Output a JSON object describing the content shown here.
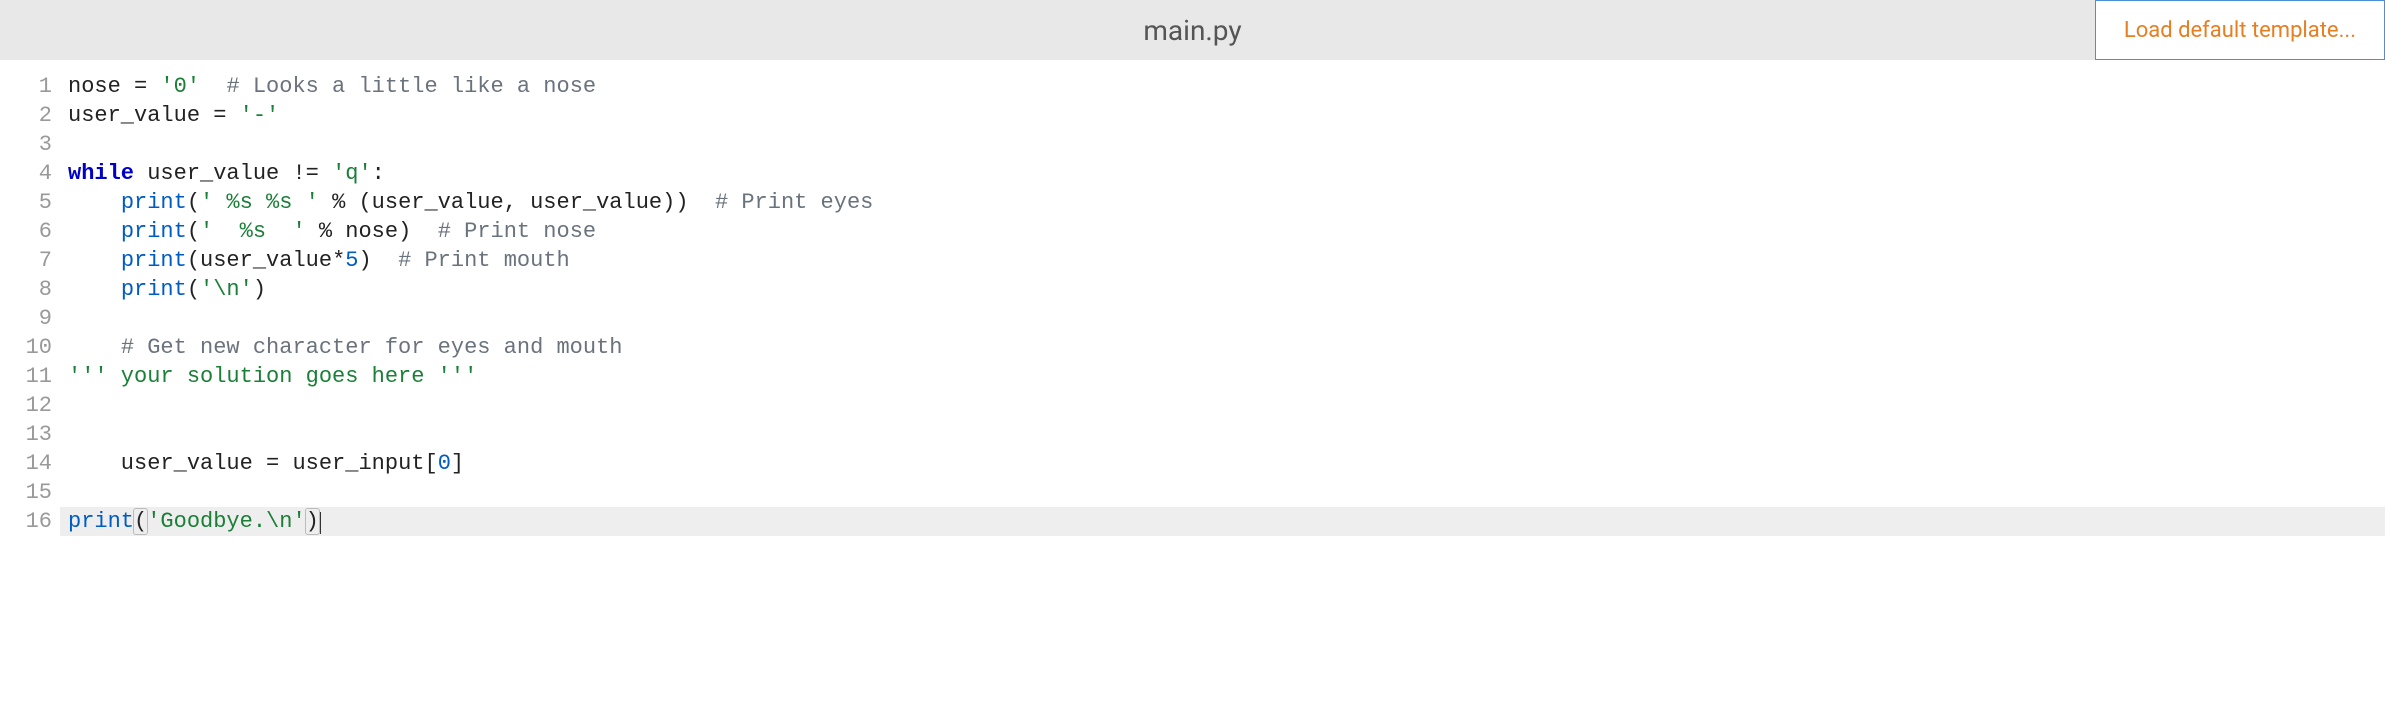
{
  "header": {
    "filename": "main.py",
    "loadTemplateLabel": "Load default template..."
  },
  "editor": {
    "activeLine": 16,
    "lineNumbers": [
      "1",
      "2",
      "3",
      "4",
      "5",
      "6",
      "7",
      "8",
      "9",
      "10",
      "11",
      "12",
      "13",
      "14",
      "15",
      "16"
    ],
    "lines": [
      [
        {
          "cls": "",
          "text": "nose "
        },
        {
          "cls": "tok-op",
          "text": "= "
        },
        {
          "cls": "tok-string",
          "text": "'0'"
        },
        {
          "cls": "",
          "text": "  "
        },
        {
          "cls": "tok-comment",
          "text": "# Looks a little like a nose"
        }
      ],
      [
        {
          "cls": "",
          "text": "user_value "
        },
        {
          "cls": "tok-op",
          "text": "= "
        },
        {
          "cls": "tok-string",
          "text": "'-'"
        }
      ],
      [],
      [
        {
          "cls": "tok-keyword",
          "text": "while"
        },
        {
          "cls": "",
          "text": " user_value "
        },
        {
          "cls": "tok-op",
          "text": "!= "
        },
        {
          "cls": "tok-string",
          "text": "'q'"
        },
        {
          "cls": "",
          "text": ":"
        }
      ],
      [
        {
          "cls": "",
          "text": "    "
        },
        {
          "cls": "tok-builtin",
          "text": "print"
        },
        {
          "cls": "",
          "text": "("
        },
        {
          "cls": "tok-string",
          "text": "' %s %s '"
        },
        {
          "cls": "",
          "text": " "
        },
        {
          "cls": "tok-op",
          "text": "%"
        },
        {
          "cls": "",
          "text": " (user_value, user_value))  "
        },
        {
          "cls": "tok-comment",
          "text": "# Print eyes"
        }
      ],
      [
        {
          "cls": "",
          "text": "    "
        },
        {
          "cls": "tok-builtin",
          "text": "print"
        },
        {
          "cls": "",
          "text": "("
        },
        {
          "cls": "tok-string",
          "text": "'  %s  '"
        },
        {
          "cls": "",
          "text": " "
        },
        {
          "cls": "tok-op",
          "text": "%"
        },
        {
          "cls": "",
          "text": " nose)  "
        },
        {
          "cls": "tok-comment",
          "text": "# Print nose"
        }
      ],
      [
        {
          "cls": "",
          "text": "    "
        },
        {
          "cls": "tok-builtin",
          "text": "print"
        },
        {
          "cls": "",
          "text": "(user_value"
        },
        {
          "cls": "tok-op",
          "text": "*"
        },
        {
          "cls": "tok-number",
          "text": "5"
        },
        {
          "cls": "",
          "text": ")  "
        },
        {
          "cls": "tok-comment",
          "text": "# Print mouth"
        }
      ],
      [
        {
          "cls": "",
          "text": "    "
        },
        {
          "cls": "tok-builtin",
          "text": "print"
        },
        {
          "cls": "",
          "text": "("
        },
        {
          "cls": "tok-string",
          "text": "'\\n'"
        },
        {
          "cls": "",
          "text": ")"
        }
      ],
      [],
      [
        {
          "cls": "",
          "text": "    "
        },
        {
          "cls": "tok-comment",
          "text": "# Get new character for eyes and mouth"
        }
      ],
      [
        {
          "cls": "tok-string",
          "text": "''' your solution goes here '''"
        }
      ],
      [],
      [],
      [
        {
          "cls": "",
          "text": "    user_value "
        },
        {
          "cls": "tok-op",
          "text": "= "
        },
        {
          "cls": "",
          "text": "user_input["
        },
        {
          "cls": "tok-number",
          "text": "0"
        },
        {
          "cls": "",
          "text": "]"
        }
      ],
      [],
      [
        {
          "cls": "tok-builtin",
          "text": "print"
        },
        {
          "cls": "bracket-highlight",
          "text": "("
        },
        {
          "cls": "tok-string",
          "text": "'Goodbye.\\n'"
        },
        {
          "cls": "bracket-highlight",
          "text": ")"
        },
        {
          "cls": "cursor",
          "text": ""
        }
      ]
    ]
  }
}
